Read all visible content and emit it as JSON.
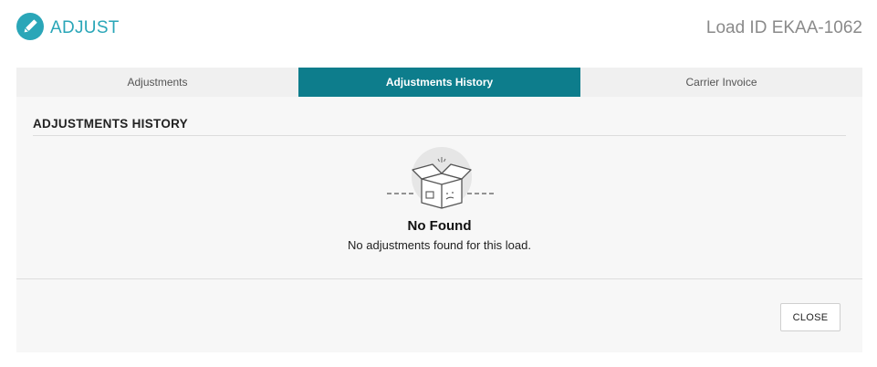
{
  "header": {
    "title": "ADJUST",
    "icon": "pencil-icon",
    "accent_color": "#2aa6b8",
    "load_id": "Load ID EKAA-1062"
  },
  "tabs": [
    {
      "label": "Adjustments",
      "active": false
    },
    {
      "label": "Adjustments History",
      "active": true
    },
    {
      "label": "Carrier Invoice",
      "active": false
    }
  ],
  "active_tab_color": "#0d7d8c",
  "section": {
    "title": "ADJUSTMENTS HISTORY"
  },
  "empty_state": {
    "icon": "empty-box-icon",
    "title": "No Found",
    "message": "No adjustments found for this load."
  },
  "footer": {
    "close_label": "CLOSE"
  }
}
